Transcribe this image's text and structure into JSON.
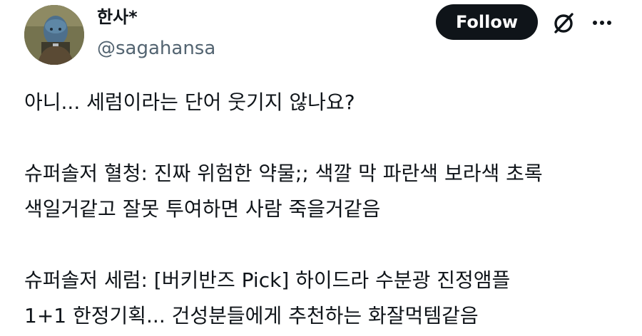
{
  "author": {
    "display_name": "한사*",
    "handle": "@sagahansa"
  },
  "actions": {
    "follow_label": "Follow",
    "grok_icon": "slashed-circle-icon",
    "more_icon": "more-horizontal-icon"
  },
  "tweet": {
    "lines": [
      "아니... 세럼이라는 단어 웃기지 않나요?",
      "",
      "슈퍼솔저 혈청: 진짜 위험한 약물;; 색깔 막 파란색 보라색 초록",
      "색일거같고 잘못 투여하면 사람 죽을거같음",
      "",
      "슈퍼솔저 세럼: [버키반즈 Pick] 하이드라 수분광 진정앰플",
      "1+1 한정기획... 건성분들에게 추천하는 화잘먹템같음"
    ]
  },
  "colors": {
    "text_primary": "#0f1419",
    "text_secondary": "#536471",
    "button_bg": "#0f1419",
    "button_text": "#ffffff"
  }
}
